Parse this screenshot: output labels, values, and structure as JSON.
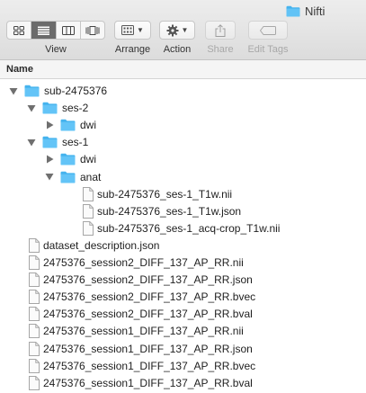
{
  "window": {
    "title": "Nifti"
  },
  "toolbar": {
    "view_label": "View",
    "arrange_label": "Arrange",
    "action_label": "Action",
    "share_label": "Share",
    "edit_tags_label": "Edit Tags",
    "view_modes": [
      "icon-view-icon",
      "list-view-icon",
      "column-view-icon",
      "cover-flow-icon"
    ],
    "active_view_mode": 1
  },
  "header": {
    "name_label": "Name"
  },
  "colors": {
    "folder": "#45b3ee",
    "active_segment": "#6b6b6b"
  },
  "rows": [
    {
      "name": "sub-2475376",
      "type": "folder",
      "level": 0,
      "expanded": true
    },
    {
      "name": "ses-2",
      "type": "folder",
      "level": 1,
      "expanded": true
    },
    {
      "name": "dwi",
      "type": "folder",
      "level": 2,
      "expanded": false
    },
    {
      "name": "ses-1",
      "type": "folder",
      "level": 1,
      "expanded": true
    },
    {
      "name": "dwi",
      "type": "folder",
      "level": 2,
      "expanded": false
    },
    {
      "name": "anat",
      "type": "folder",
      "level": 2,
      "expanded": true
    },
    {
      "name": "sub-2475376_ses-1_T1w.nii",
      "type": "file",
      "level": 3
    },
    {
      "name": "sub-2475376_ses-1_T1w.json",
      "type": "file",
      "level": 3
    },
    {
      "name": "sub-2475376_ses-1_acq-crop_T1w.nii",
      "type": "file",
      "level": 3
    },
    {
      "name": "dataset_description.json",
      "type": "file",
      "level": 0
    },
    {
      "name": "2475376_session2_DIFF_137_AP_RR.nii",
      "type": "file",
      "level": 0
    },
    {
      "name": "2475376_session2_DIFF_137_AP_RR.json",
      "type": "file",
      "level": 0
    },
    {
      "name": "2475376_session2_DIFF_137_AP_RR.bvec",
      "type": "file",
      "level": 0
    },
    {
      "name": "2475376_session2_DIFF_137_AP_RR.bval",
      "type": "file",
      "level": 0
    },
    {
      "name": "2475376_session1_DIFF_137_AP_RR.nii",
      "type": "file",
      "level": 0
    },
    {
      "name": "2475376_session1_DIFF_137_AP_RR.json",
      "type": "file",
      "level": 0
    },
    {
      "name": "2475376_session1_DIFF_137_AP_RR.bvec",
      "type": "file",
      "level": 0
    },
    {
      "name": "2475376_session1_DIFF_137_AP_RR.bval",
      "type": "file",
      "level": 0
    }
  ]
}
